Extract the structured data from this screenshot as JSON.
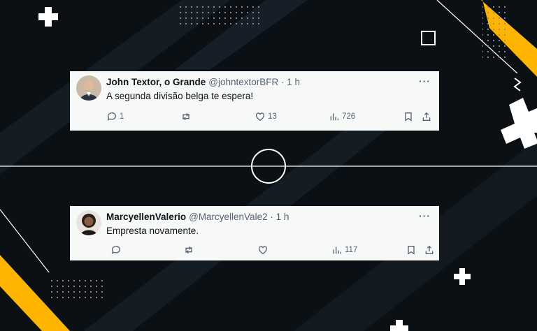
{
  "colors": {
    "background": "#0b1014",
    "accent_yellow": "#ffb400",
    "card_bg": "#f7f9f9",
    "muted_text": "#536471"
  },
  "tweets": [
    {
      "author_name": "John Textor, o Grande",
      "handle_time": "@johntextorBFR · 1 h",
      "text": "A segunda divisão belga te espera!",
      "replies": "1",
      "retweets": "",
      "likes": "13",
      "views": "726",
      "more": "···"
    },
    {
      "author_name": "MarcyellenValerio",
      "handle_time": "@MarcyellenVale2 · 1 h",
      "text": "Empresta novamente.",
      "replies": "",
      "retweets": "",
      "likes": "",
      "views": "117",
      "more": "···"
    }
  ],
  "icons": [
    "reply-icon",
    "retweet-icon",
    "like-icon",
    "views-icon",
    "bookmark-icon",
    "share-icon"
  ]
}
